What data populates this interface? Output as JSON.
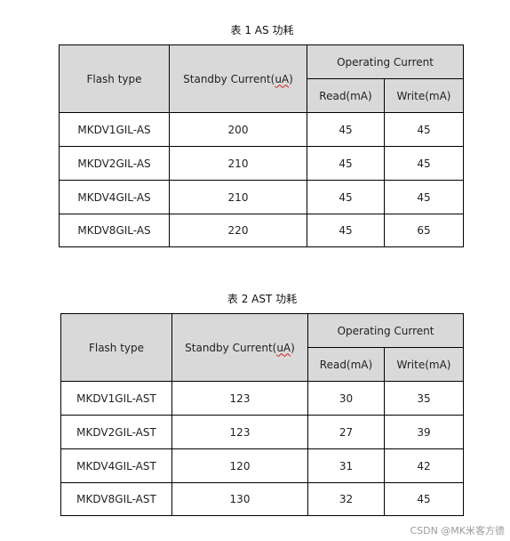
{
  "tables": [
    {
      "caption": "表 1   AS 功耗",
      "headers": {
        "flash_type": "Flash type",
        "standby_prefix": "Standby Current(",
        "standby_unit": "uA",
        "standby_suffix": ")",
        "operating": "Operating Current",
        "read": "Read(mA)",
        "write": "Write(mA)"
      },
      "rows": [
        {
          "flash_type": "MKDV1GIL-AS",
          "standby": "200",
          "read": "45",
          "write": "45"
        },
        {
          "flash_type": "MKDV2GIL-AS",
          "standby": "210",
          "read": "45",
          "write": "45"
        },
        {
          "flash_type": "MKDV4GIL-AS",
          "standby": "210",
          "read": "45",
          "write": "45"
        },
        {
          "flash_type": "MKDV8GIL-AS",
          "standby": "220",
          "read": "45",
          "write": "65"
        }
      ]
    },
    {
      "caption": "表 2   AST 功耗",
      "headers": {
        "flash_type": "Flash type",
        "standby_prefix": "Standby Current(",
        "standby_unit": "uA",
        "standby_suffix": ")",
        "operating": "Operating Current",
        "read": "Read(mA)",
        "write": "Write(mA)"
      },
      "rows": [
        {
          "flash_type": "MKDV1GIL-AST",
          "standby": "123",
          "read": "30",
          "write": "35"
        },
        {
          "flash_type": "MKDV2GIL-AST",
          "standby": "123",
          "read": "27",
          "write": "39"
        },
        {
          "flash_type": "MKDV4GIL-AST",
          "standby": "120",
          "read": "31",
          "write": "42"
        },
        {
          "flash_type": "MKDV8GIL-AST",
          "standby": "130",
          "read": "32",
          "write": "45"
        }
      ]
    }
  ],
  "watermark": "CSDN @MK米客方德"
}
